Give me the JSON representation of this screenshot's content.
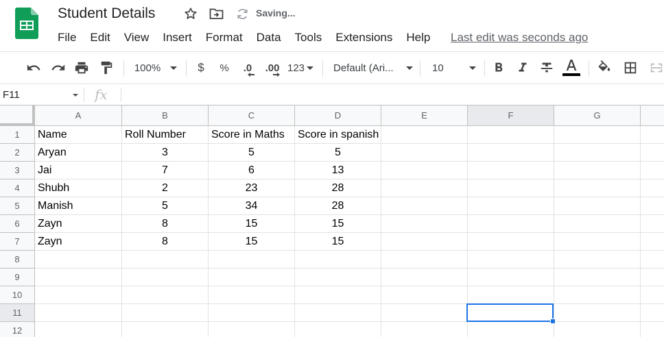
{
  "doc": {
    "title": "Student Details",
    "status": "Saving...",
    "last_edit": "Last edit was seconds ago"
  },
  "menu": [
    "File",
    "Edit",
    "View",
    "Insert",
    "Format",
    "Data",
    "Tools",
    "Extensions",
    "Help"
  ],
  "toolbar": {
    "zoom": "100%",
    "currency": "$",
    "percent": "%",
    "decrease_decimal": ".0",
    "increase_decimal": ".00",
    "more_formats": "123",
    "font": "Default (Ari...",
    "font_size": "10",
    "text_color": "#000000"
  },
  "formula_bar": {
    "cell_ref": "F11",
    "fx_label": "fx",
    "content": ""
  },
  "columns": [
    "A",
    "B",
    "C",
    "D",
    "E",
    "F",
    "G"
  ],
  "rows": [
    "1",
    "2",
    "3",
    "4",
    "5",
    "6",
    "7",
    "8",
    "9",
    "10",
    "11",
    "12"
  ],
  "sheet": {
    "header": [
      "Name",
      "Roll Number",
      "Score in Maths",
      "Score in spanish"
    ],
    "data": [
      [
        "Aryan",
        "3",
        "5",
        "5"
      ],
      [
        "Jai",
        "7",
        "6",
        "13"
      ],
      [
        "Shubh",
        "2",
        "23",
        "28"
      ],
      [
        "Manish",
        "5",
        "34",
        "28"
      ],
      [
        "Zayn",
        "8",
        "15",
        "15"
      ],
      [
        "Zayn",
        "8",
        "15",
        "15"
      ]
    ]
  },
  "selection": {
    "active_cell": "F11",
    "active_column": "F",
    "active_row": "11"
  },
  "colors": {
    "accent": "#1a73e8",
    "logo_green": "#0f9d58"
  }
}
